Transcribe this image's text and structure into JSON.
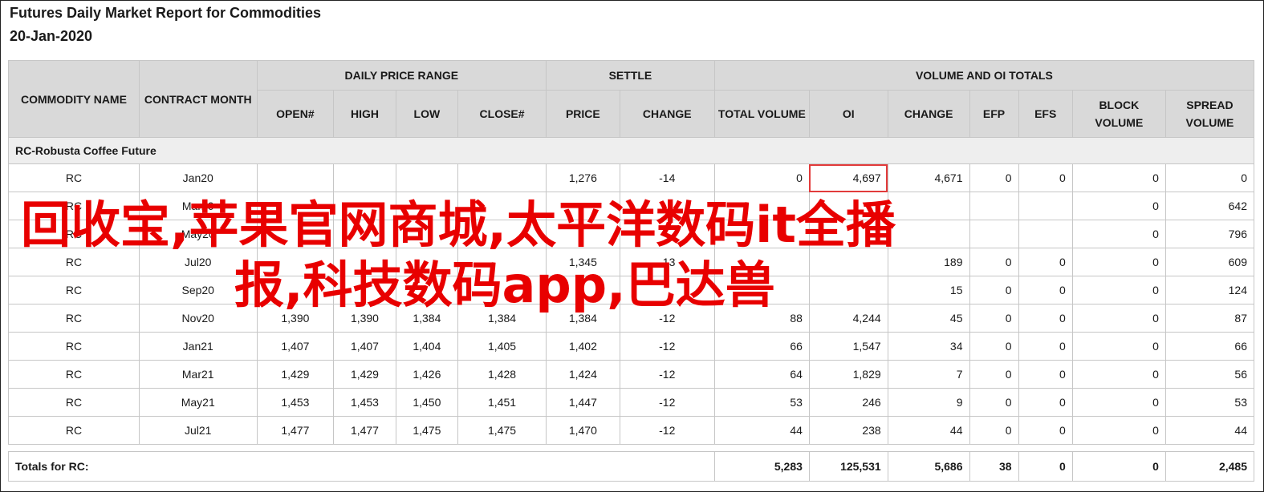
{
  "report": {
    "title": "Futures Daily Market Report for Commodities",
    "date": "20-Jan-2020"
  },
  "header": {
    "commodity_name": "COMMODITY NAME",
    "contract_month": "CONTRACT MONTH",
    "daily_price_range": "DAILY PRICE RANGE",
    "settle": "SETTLE",
    "volume_oi_totals": "VOLUME AND OI TOTALS",
    "open": "OPEN#",
    "high": "HIGH",
    "low": "LOW",
    "close": "CLOSE#",
    "price": "PRICE",
    "change": "CHANGE",
    "total_volume": "TOTAL VOLUME",
    "oi": "OI",
    "oi_change": "CHANGE",
    "efp": "EFP",
    "efs": "EFS",
    "block_volume": "BLOCK VOLUME",
    "spread_volume": "SPREAD VOLUME"
  },
  "section_title": "RC-Robusta Coffee Future",
  "rows": [
    {
      "name": "RC",
      "month": "Jan20",
      "open": "",
      "high": "",
      "low": "",
      "close": "",
      "price": "1,276",
      "change": "-14",
      "total_volume": "0",
      "oi": "4,697",
      "oi_change": "4,671",
      "efp": "0",
      "efs": "0",
      "block": "0",
      "spread": "0"
    },
    {
      "name": "RC",
      "month": "Mar20",
      "open": "",
      "high": "",
      "low": "",
      "close": "",
      "price": "",
      "change": "",
      "total_volume": "",
      "oi": "",
      "oi_change": "",
      "efp": "",
      "efs": "",
      "block": "0",
      "spread": "642"
    },
    {
      "name": "RC",
      "month": "May20",
      "open": "",
      "high": "",
      "low": "",
      "close": "",
      "price": "",
      "change": "",
      "total_volume": "",
      "oi": "",
      "oi_change": "",
      "efp": "",
      "efs": "",
      "block": "0",
      "spread": "796"
    },
    {
      "name": "RC",
      "month": "Jul20",
      "open": "",
      "high": "",
      "low": "",
      "close": "",
      "price": "1,345",
      "change": "-13",
      "total_volume": "",
      "oi": "",
      "oi_change": "189",
      "efp": "0",
      "efs": "0",
      "block": "0",
      "spread": "609"
    },
    {
      "name": "RC",
      "month": "Sep20",
      "open": "",
      "high": "",
      "low": "",
      "close": "",
      "price": "",
      "change": "",
      "total_volume": "",
      "oi": "",
      "oi_change": "15",
      "efp": "0",
      "efs": "0",
      "block": "0",
      "spread": "124"
    },
    {
      "name": "RC",
      "month": "Nov20",
      "open": "1,390",
      "high": "1,390",
      "low": "1,384",
      "close": "1,384",
      "price": "1,384",
      "change": "-12",
      "total_volume": "88",
      "oi": "4,244",
      "oi_change": "45",
      "efp": "0",
      "efs": "0",
      "block": "0",
      "spread": "87"
    },
    {
      "name": "RC",
      "month": "Jan21",
      "open": "1,407",
      "high": "1,407",
      "low": "1,404",
      "close": "1,405",
      "price": "1,402",
      "change": "-12",
      "total_volume": "66",
      "oi": "1,547",
      "oi_change": "34",
      "efp": "0",
      "efs": "0",
      "block": "0",
      "spread": "66"
    },
    {
      "name": "RC",
      "month": "Mar21",
      "open": "1,429",
      "high": "1,429",
      "low": "1,426",
      "close": "1,428",
      "price": "1,424",
      "change": "-12",
      "total_volume": "64",
      "oi": "1,829",
      "oi_change": "7",
      "efp": "0",
      "efs": "0",
      "block": "0",
      "spread": "56"
    },
    {
      "name": "RC",
      "month": "May21",
      "open": "1,453",
      "high": "1,453",
      "low": "1,450",
      "close": "1,451",
      "price": "1,447",
      "change": "-12",
      "total_volume": "53",
      "oi": "246",
      "oi_change": "9",
      "efp": "0",
      "efs": "0",
      "block": "0",
      "spread": "53"
    },
    {
      "name": "RC",
      "month": "Jul21",
      "open": "1,477",
      "high": "1,477",
      "low": "1,475",
      "close": "1,475",
      "price": "1,470",
      "change": "-12",
      "total_volume": "44",
      "oi": "238",
      "oi_change": "44",
      "efp": "0",
      "efs": "0",
      "block": "0",
      "spread": "44"
    }
  ],
  "totals": {
    "label": "Totals for RC:",
    "total_volume": "5,283",
    "oi": "125,531",
    "oi_change": "5,686",
    "efp": "38",
    "efs": "0",
    "block": "0",
    "spread": "2,485"
  },
  "overlay": {
    "line1": "回收宝,苹果官网商城,太平洋数码it全播",
    "line2": "报,科技数码app,巴达兽"
  },
  "colors": {
    "header_bg": "#d9d9d9",
    "overlay_text": "#e80000",
    "highlight_box": "#e23b3b"
  }
}
